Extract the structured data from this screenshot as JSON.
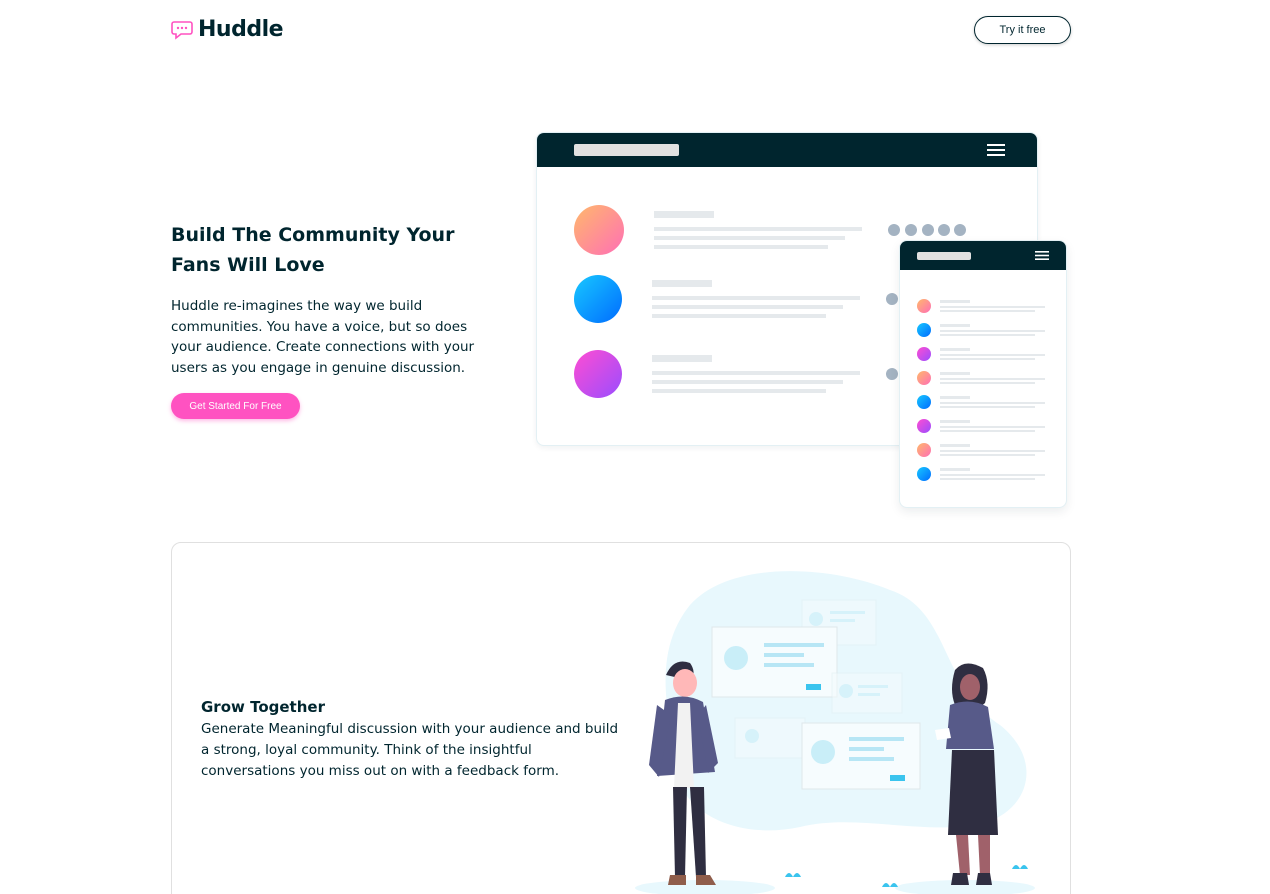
{
  "header": {
    "brand": "Huddle",
    "cta_label": "Try it free"
  },
  "hero": {
    "title": "Build The Community Your Fans Will Love",
    "description": "Huddle re-imagines the way we build communities. You have a voice, but so does your audience. Create connections with your users as you engage in genuine discussion.",
    "cta_label": "Get Started For Free"
  },
  "feature": {
    "title": "Grow Together",
    "description": "Generate Meaningful discussion with your audience and build a strong, loyal community. Think of the insightful conversations you miss out on with a feedback form."
  },
  "colors": {
    "dark": "#00252e",
    "pink": "#ff52c1",
    "card_border": "#e3f0f4"
  }
}
